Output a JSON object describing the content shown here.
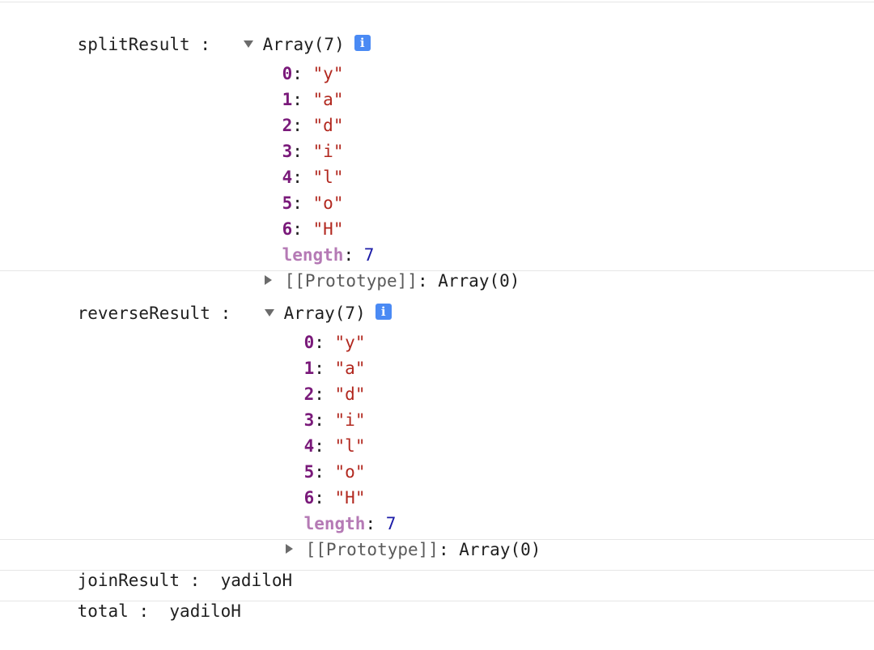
{
  "console": {
    "entries": [
      {
        "label": "splitResult",
        "separator": ":",
        "summary": "Array(7)",
        "info_icon": "i",
        "items": [
          {
            "index": "0",
            "value": "\"y\""
          },
          {
            "index": "1",
            "value": "\"a\""
          },
          {
            "index": "2",
            "value": "\"d\""
          },
          {
            "index": "3",
            "value": "\"i\""
          },
          {
            "index": "4",
            "value": "\"l\""
          },
          {
            "index": "5",
            "value": "\"o\""
          },
          {
            "index": "6",
            "value": "\"H\""
          }
        ],
        "length_key": "length",
        "length_value": "7",
        "prototype_key": "[[Prototype]]",
        "prototype_value": "Array(0)"
      },
      {
        "label": "reverseResult",
        "separator": ":",
        "summary": "Array(7)",
        "info_icon": "i",
        "items": [
          {
            "index": "0",
            "value": "\"y\""
          },
          {
            "index": "1",
            "value": "\"a\""
          },
          {
            "index": "2",
            "value": "\"d\""
          },
          {
            "index": "3",
            "value": "\"i\""
          },
          {
            "index": "4",
            "value": "\"l\""
          },
          {
            "index": "5",
            "value": "\"o\""
          },
          {
            "index": "6",
            "value": "\"H\""
          }
        ],
        "length_key": "length",
        "length_value": "7",
        "prototype_key": "[[Prototype]]",
        "prototype_value": "Array(0)"
      },
      {
        "label": "joinResult",
        "separator": ":",
        "value": "yadiloH"
      },
      {
        "label": "total",
        "separator": ":",
        "value": "yadiloH"
      }
    ],
    "colors": {
      "key": "#7a1a7a",
      "length_key": "#b57ab5",
      "string": "#b2281f",
      "number": "#1c1ca8",
      "info_badge": "#4a8af4",
      "divider": "#e6e6e6"
    },
    "icons": {
      "expanded": "triangle-down-icon",
      "collapsed": "triangle-right-icon",
      "info": "info-icon"
    }
  }
}
